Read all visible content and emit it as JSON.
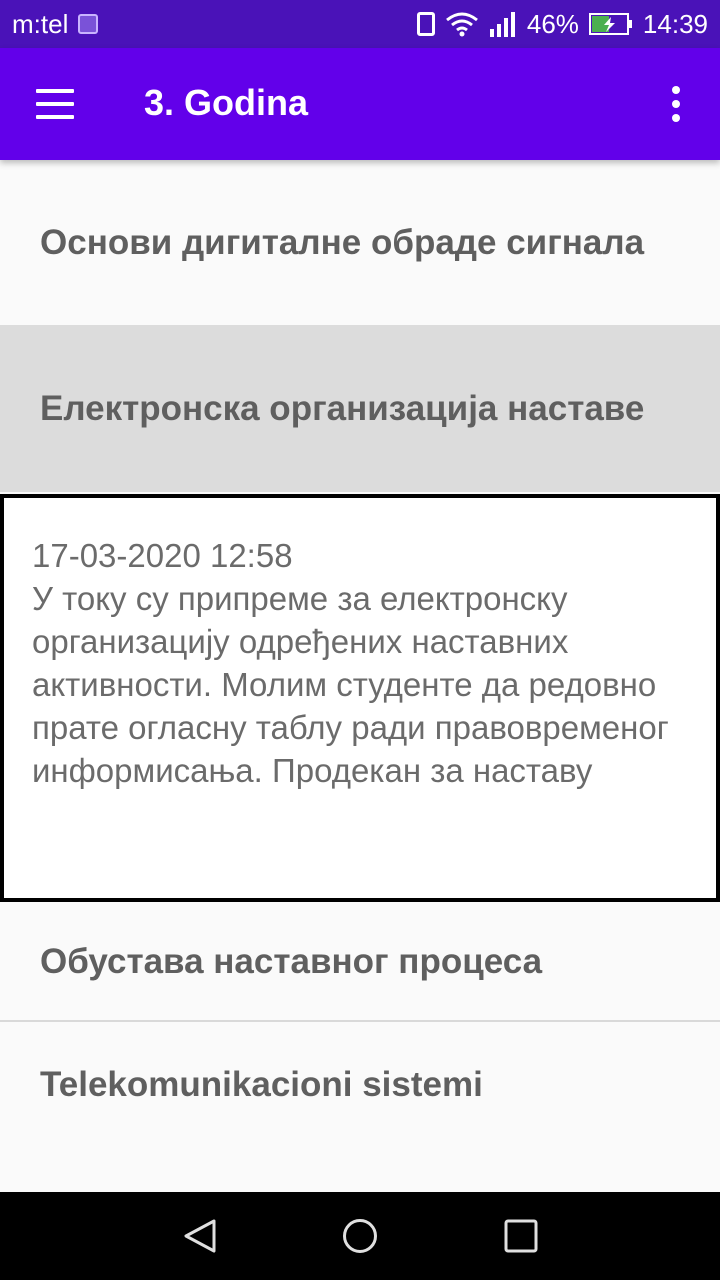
{
  "status_bar": {
    "carrier": "m:tel",
    "battery_percent": "46%",
    "time": "14:39",
    "icons": [
      "image-icon",
      "vibrate-icon",
      "wifi-icon",
      "signal-icon",
      "battery-charging-icon"
    ]
  },
  "app_bar": {
    "title": "3. Godina",
    "color": "#6200ea"
  },
  "courses": [
    {
      "title": "Основи дигиталне обраде сигнала",
      "selected": false
    },
    {
      "title": "Електронска организација наставе",
      "selected": true
    },
    {
      "title": "Обустава наставног процеса",
      "selected": false
    },
    {
      "title": "Telekomunikacioni sistemi",
      "selected": false
    }
  ],
  "notice": {
    "date": "17-03-2020  12:58",
    "body": "У току су припреме за електронску организацију одређених наставних активности. Молим студенте да редовно прате огласну таблу ради правовременог информисања. Продекан за наставу"
  },
  "nav": {
    "icons": [
      "back-icon",
      "home-icon",
      "recents-icon"
    ]
  }
}
